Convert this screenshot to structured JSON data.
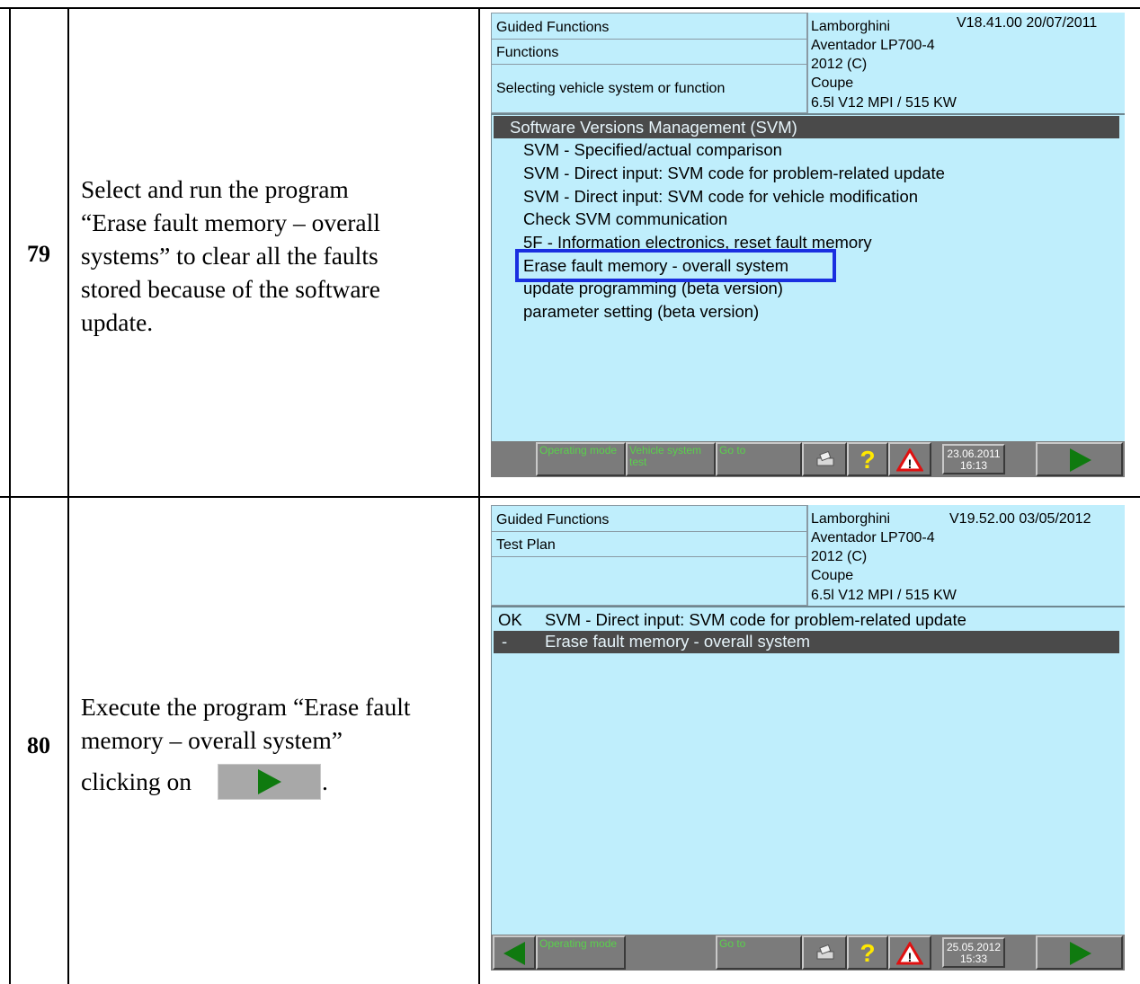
{
  "steps": [
    {
      "number": "79",
      "text_lines": [
        "Select and run the program",
        "“Erase fault memory – overall",
        "systems” to clear all the faults",
        "stored because of the software",
        "update."
      ],
      "screen": {
        "left_header": [
          "Guided Functions",
          "Functions",
          "Selecting vehicle system or function"
        ],
        "make": "Lamborghini",
        "version": "V18.41.00 20/07/2011",
        "vehicle_lines": [
          "Aventador LP700-4",
          "2012 (C)",
          "Coupe",
          "6.5l V12 MPI / 515 KW"
        ],
        "list_header": "Software Versions Management (SVM)",
        "list_items": [
          "SVM - Specified/actual comparison",
          "SVM - Direct input: SVM code for problem-related update",
          "SVM - Direct input: SVM code for vehicle modification",
          "Check SVM communication",
          "5F - Information electronics, reset fault memory",
          "Erase fault memory - overall system",
          "update programming (beta version)",
          "parameter setting (beta version)"
        ],
        "toolbar": {
          "operating_mode": "Operating mode",
          "vehicle_system": "Vehicle system\ntest",
          "go_to": "Go to",
          "date": "23.06.2011",
          "time": "16:13"
        }
      }
    },
    {
      "number": "80",
      "text_lines": [
        "Execute the program “Erase fault",
        "memory – overall system”",
        "clicking on",
        "."
      ],
      "screen": {
        "left_header": [
          "Guided Functions",
          "Test Plan",
          ""
        ],
        "make": "Lamborghini",
        "version": "V19.52.00 03/05/2012",
        "vehicle_lines": [
          "Aventador LP700-4",
          "2012 (C)",
          "Coupe",
          "6.5l V12 MPI / 515 KW"
        ],
        "plan_rows": [
          {
            "status": "OK",
            "label": "SVM - Direct input: SVM code for problem-related update"
          },
          {
            "status": "-",
            "label": "Erase fault memory - overall system"
          }
        ],
        "toolbar": {
          "operating_mode": "Operating mode",
          "go_to": "Go to",
          "date": "25.05.2012",
          "time": "15:33"
        }
      }
    }
  ],
  "colors": {
    "screen_bg": "#bfeefc",
    "selected_row": "#4a4a4a",
    "highlight_box": "#1a2fe0",
    "toolbar": "#7b7b7b",
    "button_text": "#59d14b",
    "arrow_green": "#0f7a0f"
  },
  "icons": [
    "printer-icon",
    "help-icon",
    "warning-icon",
    "play-arrow-icon",
    "back-arrow-icon"
  ]
}
